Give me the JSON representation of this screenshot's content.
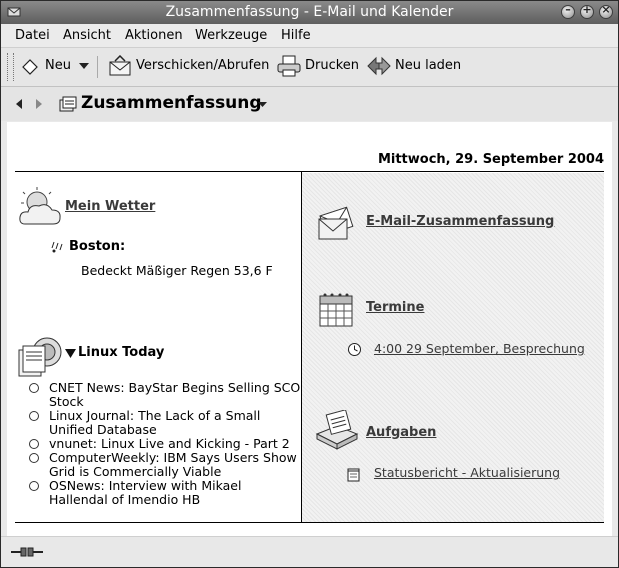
{
  "window": {
    "title": "Zusammenfassung - E-Mail und Kalender"
  },
  "menu": [
    "Datei",
    "Ansicht",
    "Aktionen",
    "Werkzeuge",
    "Hilfe"
  ],
  "toolbar": {
    "new_label": "Neu",
    "send_receive_label": "Verschicken/Abrufen",
    "print_label": "Drucken",
    "reload_label": "Neu laden"
  },
  "nav": {
    "title": "Zusammenfassung"
  },
  "summary": {
    "date": "Mittwoch, 29. September 2004",
    "weather": {
      "title": "Mein Wetter",
      "city": "Boston",
      "city_suffix": ":",
      "condition": "Bedeckt Mäßiger Regen 53,6 F"
    },
    "news": {
      "title": "Linux Today",
      "items": [
        {
          "line1": "CNET News: BayStar Begins Selling SCO",
          "line2": "Stock"
        },
        {
          "line1": "Linux Journal: The Lack of a Small",
          "line2": "Unified Database"
        },
        {
          "line1": "vnunet: Linux Live and Kicking - Part 2",
          "line2": ""
        },
        {
          "line1": "ComputerWeekly: IBM Says Users Show",
          "line2": "Grid is Commercially Viable"
        },
        {
          "line1": "OSNews: Interview with Mikael",
          "line2": "Hallendal of Imendio HB"
        }
      ]
    },
    "mail": {
      "title": "E-Mail-Zusammenfassung"
    },
    "appointments": {
      "title": "Termine",
      "item": "4:00 29 September, Besprechung"
    },
    "tasks": {
      "title": "Aufgaben",
      "item": "Statusbericht - Aktualisierung"
    }
  }
}
